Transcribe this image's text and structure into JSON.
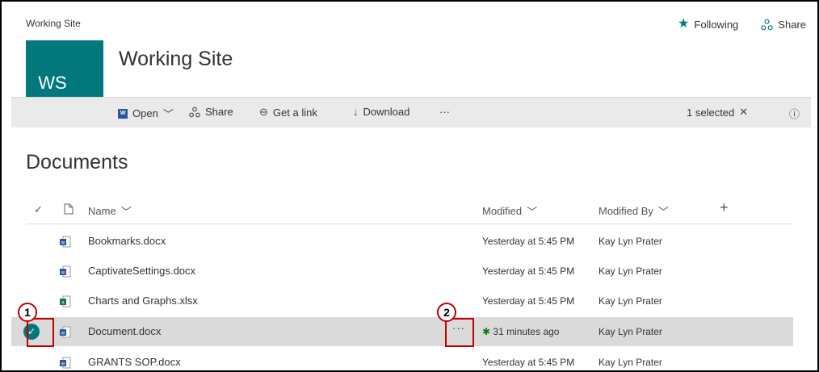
{
  "header": {
    "site_small": "Working Site",
    "following_label": "Following",
    "share_label": "Share",
    "logo_text": "WS",
    "site_title": "Working Site"
  },
  "toolbar": {
    "open_label": "Open",
    "share_label": "Share",
    "get_link_label": "Get a link",
    "download_label": "Download",
    "more_label": "···",
    "selected_label": "1 selected",
    "close_glyph": "✕",
    "info_glyph": "ⓘ"
  },
  "library": {
    "title": "Documents",
    "columns": {
      "name": "Name",
      "modified": "Modified",
      "modified_by": "Modified By",
      "add_column": "+"
    },
    "rows": [
      {
        "name": "Bookmarks.docx",
        "type": "word",
        "modified": "Yesterday at 5:45 PM",
        "modified_by": "Kay Lyn Prater",
        "selected": false
      },
      {
        "name": "CaptivateSettings.docx",
        "type": "word",
        "modified": "Yesterday at 5:45 PM",
        "modified_by": "Kay Lyn Prater",
        "selected": false
      },
      {
        "name": "Charts and Graphs.xlsx",
        "type": "excel",
        "modified": "Yesterday at 5:45 PM",
        "modified_by": "Kay Lyn Prater",
        "selected": false
      },
      {
        "name": "Document.docx",
        "type": "word",
        "modified": "31 minutes ago",
        "modified_by": "Kay Lyn Prater",
        "selected": true,
        "new_marker": "✱"
      },
      {
        "name": "GRANTS SOP.docx",
        "type": "word",
        "modified": "Yesterday at 5:45 PM",
        "modified_by": "Kay Lyn Prater",
        "selected": false
      }
    ]
  },
  "callouts": {
    "one": "1",
    "two": "2"
  },
  "colors": {
    "accent": "#03787c",
    "word": "#2b579a",
    "excel": "#217346",
    "callout": "#c00000",
    "selected_row": "#dadada"
  },
  "icons": {
    "following": "star-icon",
    "share": "share-icon",
    "open": "word-icon",
    "get_link": "link-icon",
    "download": "download-icon",
    "info": "info-icon"
  }
}
